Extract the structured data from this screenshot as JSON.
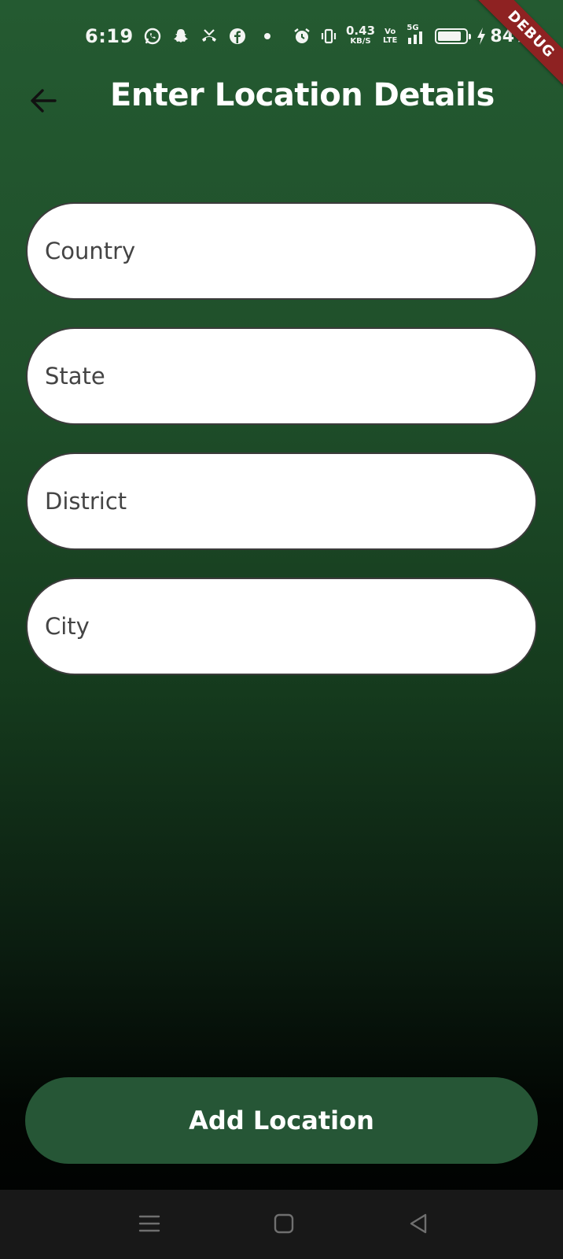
{
  "status_bar": {
    "time": "6:19",
    "network_speed_value": "0.43",
    "network_speed_unit": "KB/S",
    "volte_top": "Vo",
    "volte_bottom": "LTE",
    "signal_label": "5G",
    "battery_percent": "84%",
    "battery_level": 0.84,
    "icons": [
      "whatsapp-icon",
      "snapchat-icon",
      "missed-call-icon",
      "facebook-icon",
      "alarm-icon",
      "vibrate-icon",
      "signal-icon",
      "battery-icon",
      "charging-icon"
    ]
  },
  "debug_banner": "DEBUG",
  "app_bar": {
    "title": "Enter Location Details",
    "back_icon": "arrow-left-icon"
  },
  "form": {
    "country_placeholder": "Country",
    "state_placeholder": "State",
    "district_placeholder": "District",
    "city_placeholder": "City"
  },
  "submit": {
    "label": "Add Location"
  },
  "nav_bar": {
    "icons": [
      "menu-icon",
      "home-icon",
      "back-triangle-icon"
    ]
  },
  "colors": {
    "gradient_top": "#245a31",
    "gradient_bottom": "#000000",
    "button_bg": "#265636",
    "debug_ribbon": "#8e2222",
    "field_bg": "#ffffff"
  }
}
